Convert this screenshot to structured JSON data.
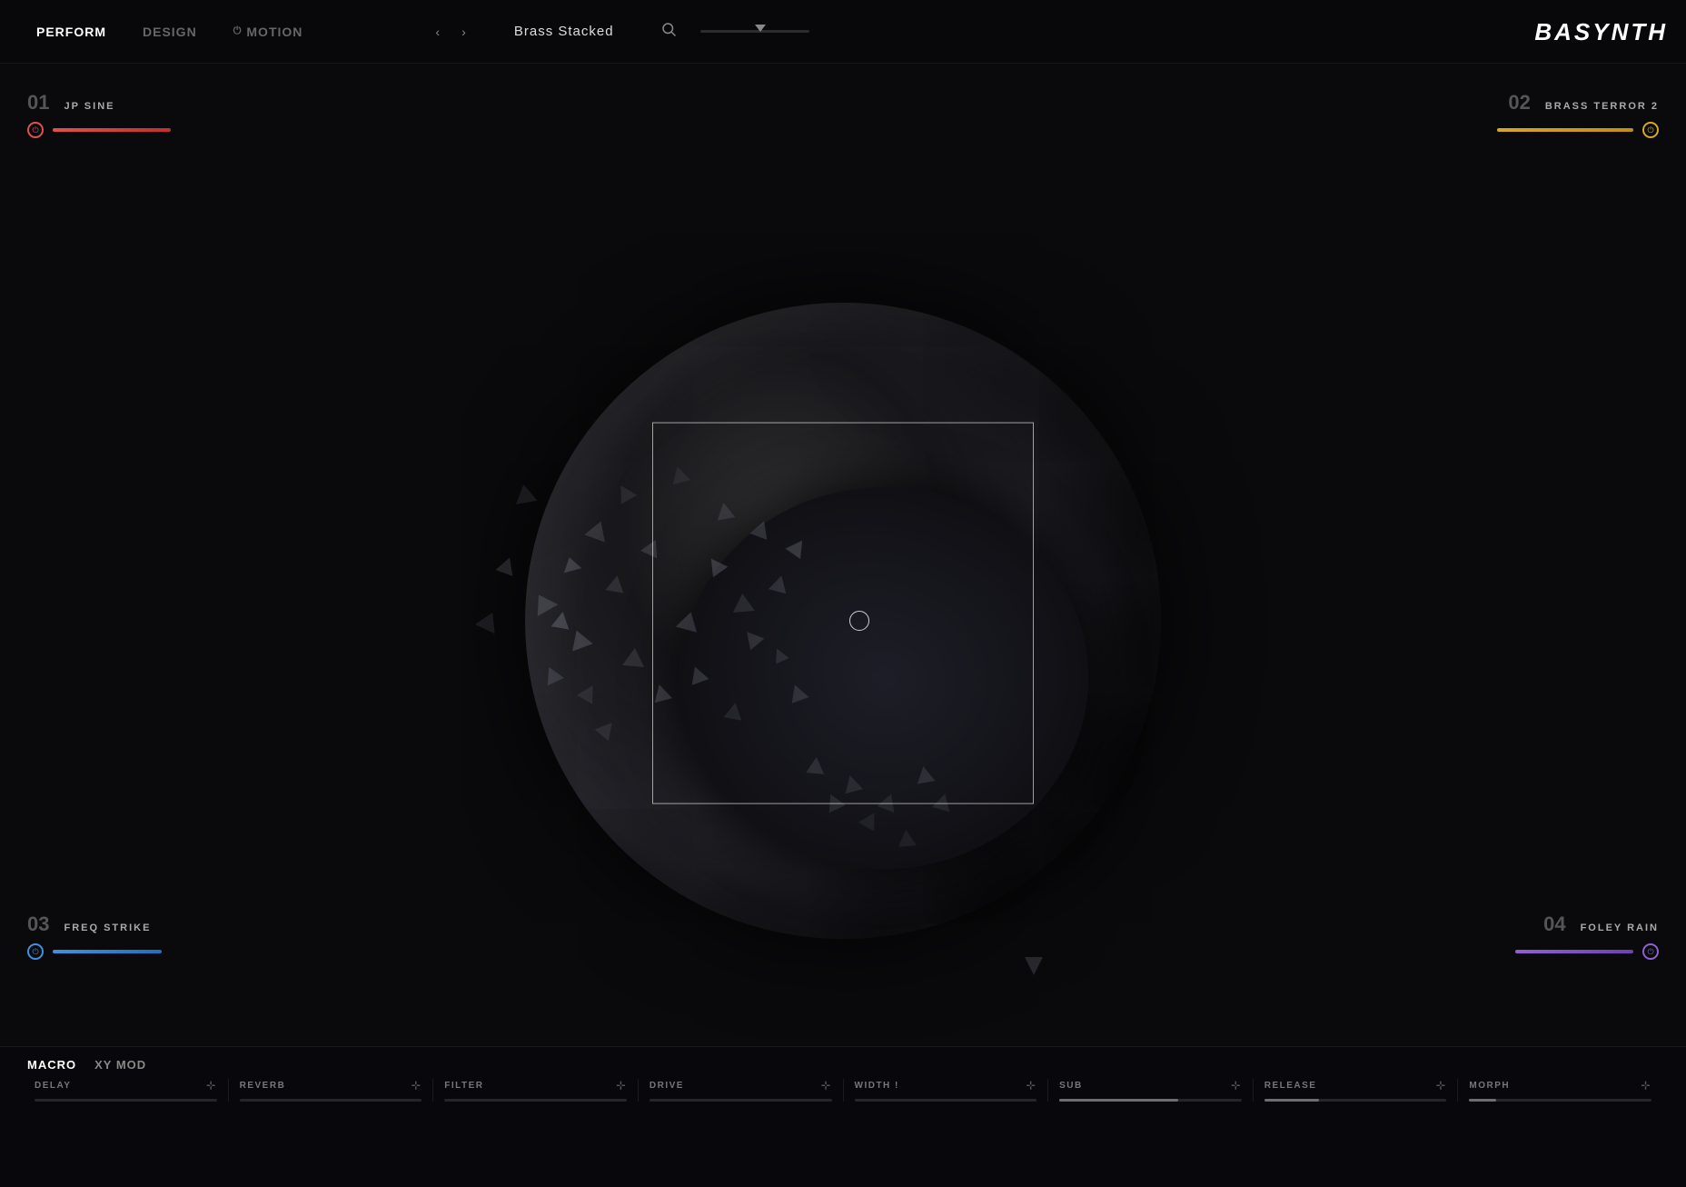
{
  "header": {
    "tabs": [
      {
        "label": "PERFORM",
        "active": true
      },
      {
        "label": "DESIGN",
        "active": false
      },
      {
        "label": "MOTION",
        "active": false
      }
    ],
    "nav_prev": "‹",
    "nav_next": "›",
    "preset_name": "Brass Stacked",
    "search_icon": "🔍",
    "logo": "BASYNTH"
  },
  "layers": {
    "slot01": {
      "number": "01",
      "name": "JP SINE",
      "power_state": "on",
      "color": "red"
    },
    "slot02": {
      "number": "02",
      "name": "BRASS TERROR 2",
      "power_state": "on",
      "color": "yellow"
    },
    "slot03": {
      "number": "03",
      "name": "FREQ STRIKE",
      "power_state": "on",
      "color": "blue"
    },
    "slot04": {
      "number": "04",
      "name": "FOLEY RAIN",
      "power_state": "on",
      "color": "purple"
    }
  },
  "bottom": {
    "tabs": [
      {
        "label": "MACRO",
        "active": true
      },
      {
        "label": "XY MOD",
        "active": false
      }
    ],
    "macros": [
      {
        "label": "DELAY",
        "fill": 0
      },
      {
        "label": "REVERB",
        "fill": 0
      },
      {
        "label": "FILTER",
        "fill": 0
      },
      {
        "label": "DRIVE",
        "fill": 0
      },
      {
        "label": "WIDTH !",
        "fill": 0
      },
      {
        "label": "SUB",
        "fill": 65
      },
      {
        "label": "RELEASE",
        "fill": 30
      },
      {
        "label": "MORPH",
        "fill": 15
      }
    ]
  }
}
